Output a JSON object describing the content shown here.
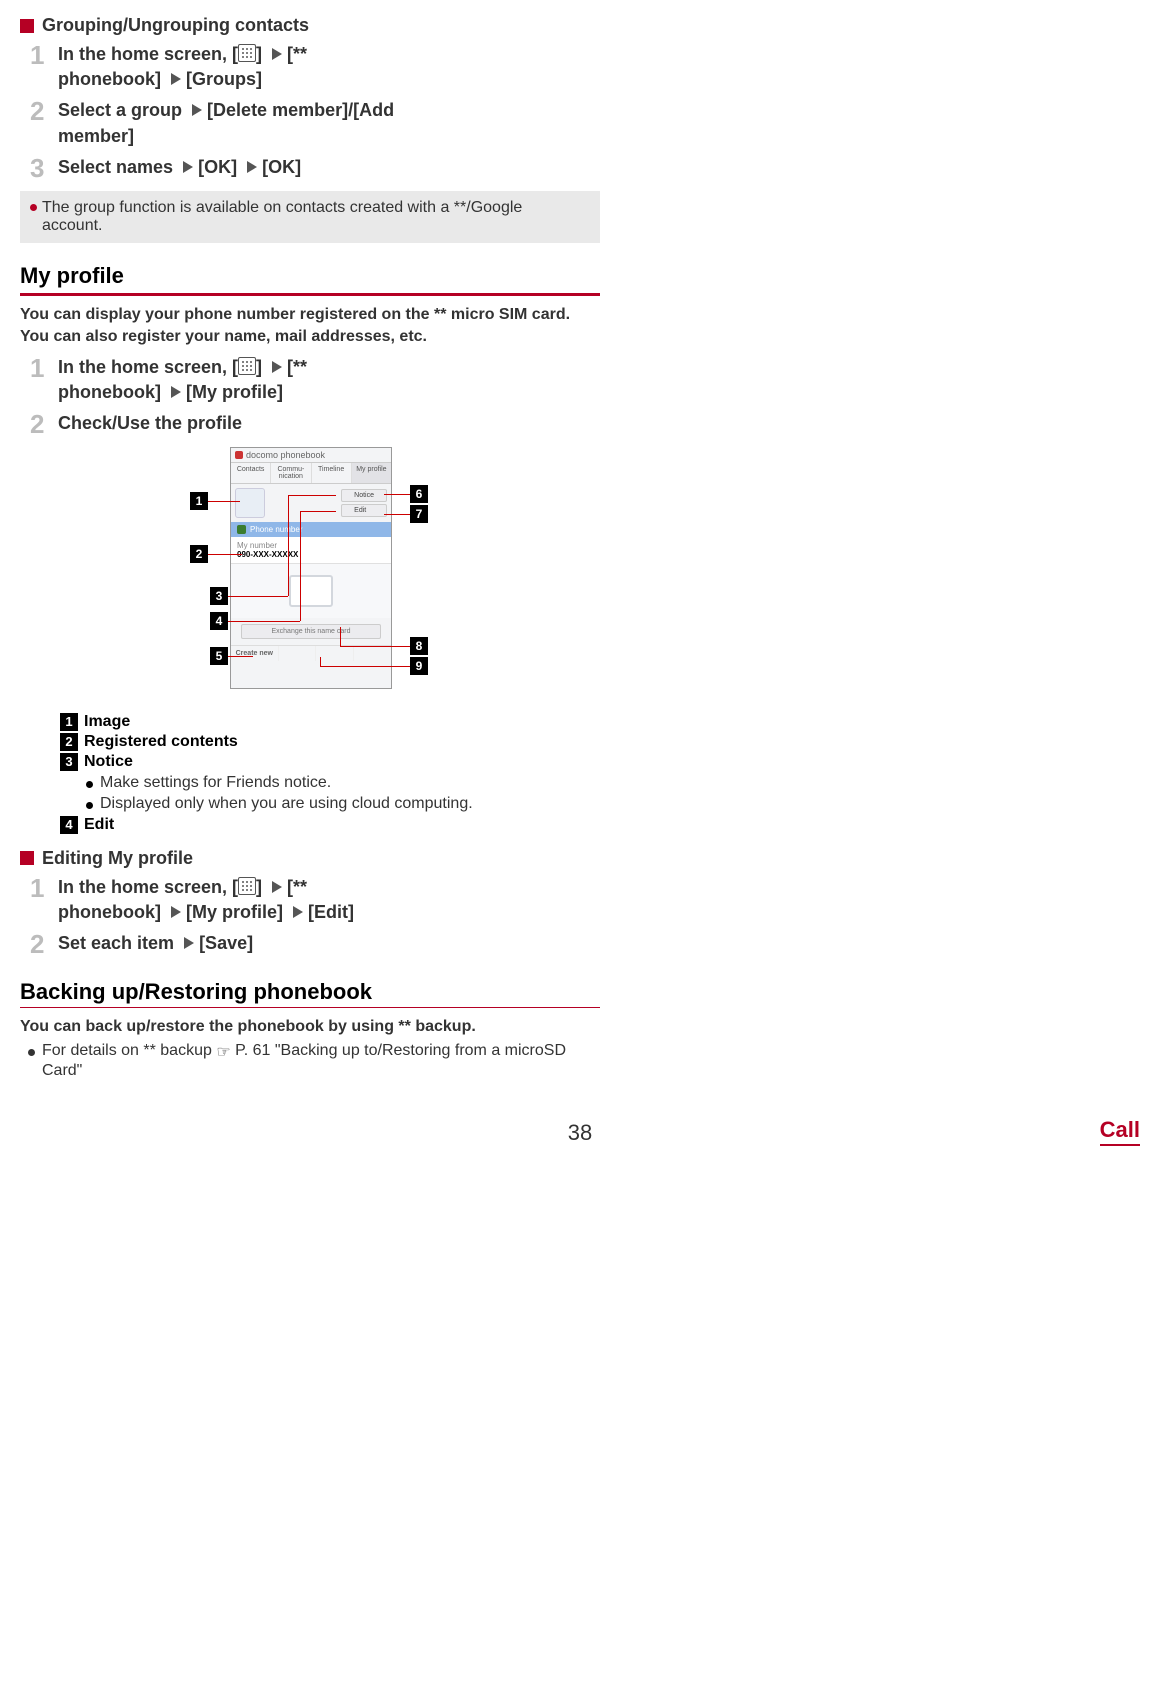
{
  "grouping": {
    "title": "Grouping/Ungrouping contacts",
    "steps": [
      "In the home screen, [APPS] ▶ [** phonebook] ▶ [Groups]",
      "Select a group ▶ [Delete member]/[Add member]",
      "Select names ▶ [OK] ▶ [OK]"
    ],
    "step1_line1": "In the home screen, [",
    "step1_line1_end": "] ",
    "step1_line1_cont": "[** ",
    "step1_line2": "phonebook] ",
    "step1_line2_end": "[Groups]",
    "step2_a": "Select a group ",
    "step2_b": "[Delete member]/[Add ",
    "step2_c": "member]",
    "step3_a": "Select names ",
    "step3_b": "[OK] ",
    "step3_c": "[OK]",
    "note": "The group function is available on contacts created with a **/Google account."
  },
  "myprofile": {
    "heading": "My profile",
    "intro": "You can display your phone number registered on the ** micro SIM card. You can also register your name, mail addresses, etc.",
    "step1_line1": "In the home screen, [",
    "step1_line1_end": "] ",
    "step1_line1_cont": "[** ",
    "step1_line2": "phonebook] ",
    "step1_line2_end": "[My profile]",
    "step2": "Check/Use the profile",
    "screenshot": {
      "app_title": "docomo phonebook",
      "tabs": [
        "Contacts",
        "Commu-nication",
        "Timeline",
        "My profile"
      ],
      "notice_btn": "Notice",
      "edit_btn": "Edit",
      "phone_label": "Phone number",
      "my_number_label": "My number",
      "my_number": "090-XXX-XXXXX",
      "exchange": "Exchange this name card",
      "create": "Create new",
      "br1": "",
      "br2": "",
      "br3": ""
    },
    "callouts": {
      "1": "Image",
      "2": "Registered contents",
      "3": "Notice",
      "3_sub1": "Make settings for Friends notice.",
      "3_sub2": "Displayed only when you are using cloud computing.",
      "4": "Edit"
    }
  },
  "editing": {
    "title": "Editing My profile",
    "step1_line1": "In the home screen, [",
    "step1_line1_end": "] ",
    "step1_line1_cont": "[** ",
    "step1_line2": "phonebook] ",
    "step1_line2_mid": "[My profile] ",
    "step1_line2_end": "[Edit]",
    "step2_a": "Set each item ",
    "step2_b": "[Save]"
  },
  "backup": {
    "heading": "Backing up/Restoring phonebook",
    "intro": "You can back up/restore the phonebook by using ** backup.",
    "bullet_a": "For details on ** backup ",
    "bullet_b": "P. 61 \"Backing up to/Restoring from a microSD Card\""
  },
  "footer": {
    "page_num": "38",
    "section": "Call"
  }
}
